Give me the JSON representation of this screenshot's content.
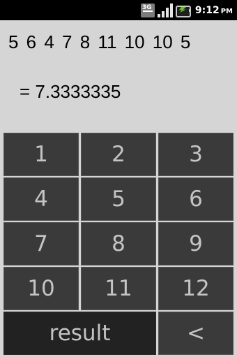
{
  "statusbar": {
    "network_label": "3G",
    "time": "9:12",
    "ampm": "PM"
  },
  "display": {
    "sequence": "5  6  4  7  8  11  10  10  5",
    "result": "= 7.3333335"
  },
  "keypad": {
    "keys": [
      "1",
      "2",
      "3",
      "4",
      "5",
      "6",
      "7",
      "8",
      "9",
      "10",
      "11",
      "12"
    ],
    "result_label": "result",
    "back_label": "<"
  }
}
